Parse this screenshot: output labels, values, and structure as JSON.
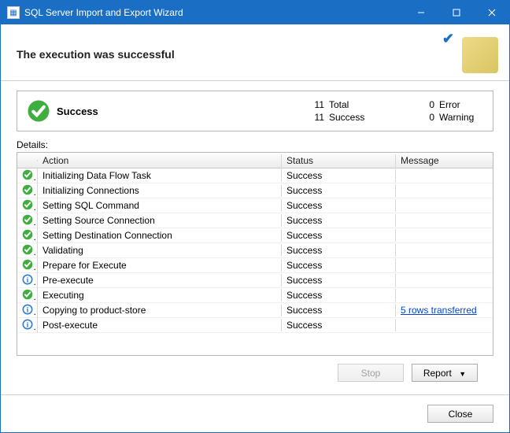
{
  "window": {
    "title": "SQL Server Import and Export Wizard"
  },
  "header": {
    "heading": "The execution was successful"
  },
  "summary": {
    "label": "Success",
    "stats": {
      "total_n": "11",
      "total_l": "Total",
      "success_n": "11",
      "success_l": "Success",
      "error_n": "0",
      "error_l": "Error",
      "warning_n": "0",
      "warning_l": "Warning"
    }
  },
  "details_label": "Details:",
  "columns": {
    "action": "Action",
    "status": "Status",
    "message": "Message"
  },
  "rows": [
    {
      "icon": "success",
      "action": "Initializing Data Flow Task",
      "status": "Success",
      "message": ""
    },
    {
      "icon": "success",
      "action": "Initializing Connections",
      "status": "Success",
      "message": ""
    },
    {
      "icon": "success",
      "action": "Setting SQL Command",
      "status": "Success",
      "message": ""
    },
    {
      "icon": "success",
      "action": "Setting Source Connection",
      "status": "Success",
      "message": ""
    },
    {
      "icon": "success",
      "action": "Setting Destination Connection",
      "status": "Success",
      "message": ""
    },
    {
      "icon": "success",
      "action": "Validating",
      "status": "Success",
      "message": ""
    },
    {
      "icon": "success",
      "action": "Prepare for Execute",
      "status": "Success",
      "message": ""
    },
    {
      "icon": "info",
      "action": "Pre-execute",
      "status": "Success",
      "message": ""
    },
    {
      "icon": "success",
      "action": "Executing",
      "status": "Success",
      "message": ""
    },
    {
      "icon": "info",
      "action": "Copying to product-store",
      "status": "Success",
      "message": "5 rows transferred",
      "link": true
    },
    {
      "icon": "info",
      "action": "Post-execute",
      "status": "Success",
      "message": ""
    }
  ],
  "buttons": {
    "stop": "Stop",
    "report": "Report",
    "close": "Close"
  }
}
